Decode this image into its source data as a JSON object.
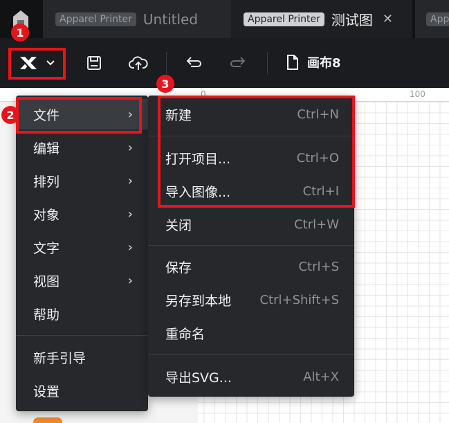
{
  "tabs": [
    {
      "badge": "Apparel Printer",
      "title": "Untitled",
      "active": false
    },
    {
      "badge": "Apparel Printer",
      "title": "测试图",
      "active": true
    },
    {
      "badge": "Appa",
      "title": "",
      "active": false
    }
  ],
  "toolbar": {
    "canvas_name": "画布8"
  },
  "ruler": {
    "labels": [
      "0",
      "100"
    ]
  },
  "main_menu": {
    "items": [
      {
        "label": "文件",
        "has_submenu": true,
        "highlighted": true
      },
      {
        "label": "编辑",
        "has_submenu": true
      },
      {
        "label": "排列",
        "has_submenu": true
      },
      {
        "label": "对象",
        "has_submenu": true
      },
      {
        "label": "文字",
        "has_submenu": true
      },
      {
        "label": "视图",
        "has_submenu": true
      },
      {
        "label": "帮助",
        "has_submenu": false
      },
      {
        "label": "新手引导",
        "has_submenu": false
      },
      {
        "label": "设置",
        "has_submenu": false
      }
    ],
    "arrow": "›"
  },
  "file_menu": {
    "items": [
      {
        "label": "新建",
        "shortcut": "Ctrl+N"
      },
      {
        "label": "打开项目...",
        "shortcut": "Ctrl+O"
      },
      {
        "label": "导入图像...",
        "shortcut": "Ctrl+I"
      },
      {
        "label": "关闭",
        "shortcut": "Ctrl+W"
      },
      {
        "label": "保存",
        "shortcut": "Ctrl+S"
      },
      {
        "label": "另存到本地",
        "shortcut": "Ctrl+Shift+S"
      },
      {
        "label": "重命名",
        "shortcut": ""
      },
      {
        "label": "导出SVG...",
        "shortcut": "Alt+X"
      }
    ]
  },
  "annotations": {
    "badges": [
      "1",
      "2",
      "3"
    ],
    "color": "#e8141b"
  },
  "icons": {
    "home": "home-icon",
    "logo": "xtool-logo-icon",
    "chevron": "chevron-down-icon",
    "save": "save-icon",
    "cloud": "cloud-upload-icon",
    "undo": "undo-icon",
    "redo": "redo-icon",
    "document": "document-icon",
    "close": "close-icon"
  },
  "colors": {
    "tabbar_bg": "#111214",
    "toolbar_bg": "#1b1c1f",
    "menu_bg": "#26282c",
    "menu_highlight": "#393c41",
    "annotation_red": "#e8141b"
  }
}
